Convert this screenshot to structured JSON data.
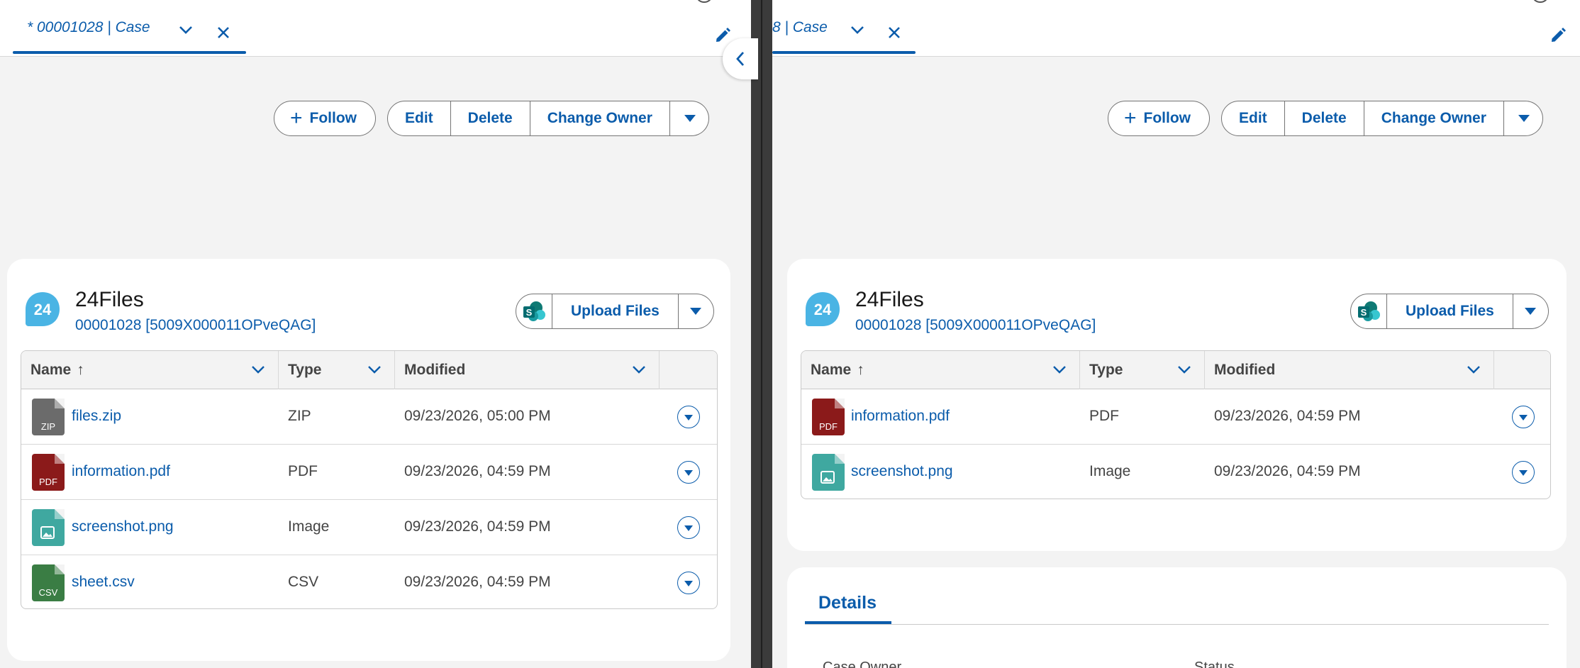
{
  "colors": {
    "brand": "#0b5cab",
    "zip": "#6b6b6b",
    "pdf": "#8b1a1a",
    "image": "#3fa8a0",
    "csv": "#3a7d44",
    "logo": "#4ab4e4",
    "sharepoint": "#0f7a74"
  },
  "left": {
    "tab": {
      "label": "* 00001028 | Case"
    },
    "actions": {
      "follow": "Follow",
      "edit": "Edit",
      "delete": "Delete",
      "change_owner": "Change Owner"
    },
    "files": {
      "logo_text": "24",
      "title": "24Files",
      "subtitle": "00001028 [5009X000011OPveQAG]",
      "upload_label": "Upload Files",
      "columns": {
        "name": "Name",
        "name_sort": "↑",
        "type": "Type",
        "modified": "Modified"
      },
      "rows": [
        {
          "icon": "zip-file-icon",
          "ext": "ZIP",
          "name": "files.zip",
          "type": "ZIP",
          "modified": "09/23/2026, 05:00 PM"
        },
        {
          "icon": "pdf-file-icon",
          "ext": "PDF",
          "name": "information.pdf",
          "type": "PDF",
          "modified": "09/23/2026, 04:59 PM"
        },
        {
          "icon": "image-file-icon",
          "ext": "",
          "name": "screenshot.png",
          "type": "Image",
          "modified": "09/23/2026, 04:59 PM"
        },
        {
          "icon": "csv-file-icon",
          "ext": "CSV",
          "name": "sheet.csv",
          "type": "CSV",
          "modified": "09/23/2026, 04:59 PM"
        }
      ]
    }
  },
  "right": {
    "tab": {
      "label": "8 | Case"
    },
    "actions": {
      "follow": "Follow",
      "edit": "Edit",
      "delete": "Delete",
      "change_owner": "Change Owner"
    },
    "files": {
      "logo_text": "24",
      "title": "24Files",
      "subtitle": "00001028 [5009X000011OPveQAG]",
      "upload_label": "Upload Files",
      "columns": {
        "name": "Name",
        "name_sort": "↑",
        "type": "Type",
        "modified": "Modified"
      },
      "rows": [
        {
          "icon": "pdf-file-icon",
          "ext": "PDF",
          "name": "information.pdf",
          "type": "PDF",
          "modified": "09/23/2026, 04:59 PM"
        },
        {
          "icon": "image-file-icon",
          "ext": "",
          "name": "screenshot.png",
          "type": "Image",
          "modified": "09/23/2026, 04:59 PM"
        }
      ]
    },
    "details": {
      "tab_label": "Details",
      "field_1": "Case Owner",
      "field_2": "Status"
    }
  }
}
